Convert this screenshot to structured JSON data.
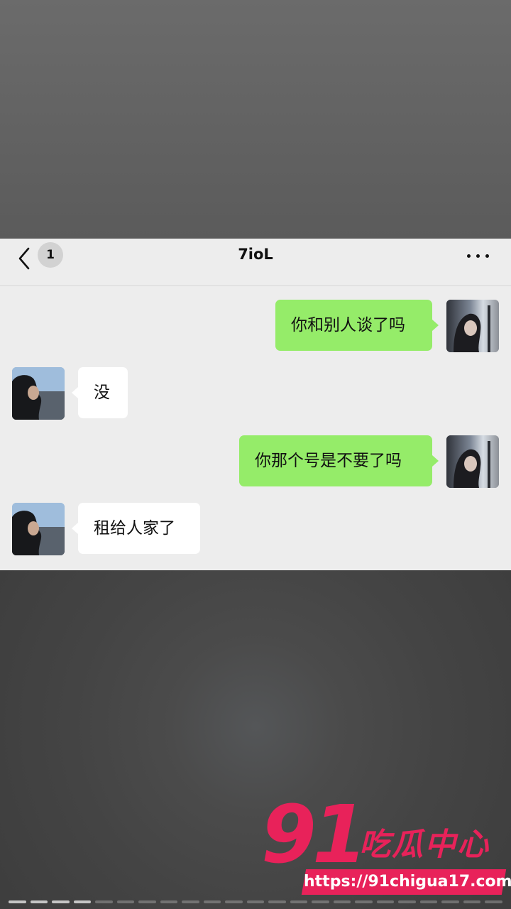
{
  "header": {
    "title": "7ioL",
    "unread_count": "1",
    "back_icon": "chevron-left-icon",
    "more_icon": "more-dots-icon"
  },
  "messages": [
    {
      "side": "right",
      "text": "你和别人谈了吗",
      "bubble_color": "#95ec69"
    },
    {
      "side": "left",
      "text": "没",
      "bubble_color": "#ffffff"
    },
    {
      "side": "right",
      "text": "你那个号是不要了吗",
      "bubble_color": "#95ec69"
    },
    {
      "side": "left",
      "text": "租给人家了",
      "bubble_color": "#ffffff"
    }
  ],
  "watermark": {
    "logo_number": "91",
    "logo_text": "吃瓜中心",
    "url": "https://91chigua17.com",
    "color": "#e8225a"
  },
  "story_progress": {
    "segments_total": 23,
    "segments_done": 4
  }
}
